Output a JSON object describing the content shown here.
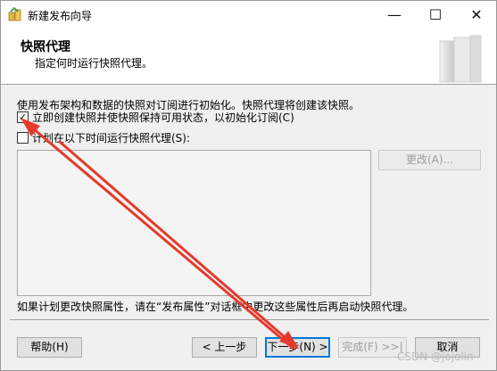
{
  "window": {
    "title": "新建发布向导",
    "minimize_label": "—",
    "maximize_label": "☐",
    "close_label": "✕"
  },
  "header": {
    "title": "快照代理",
    "subtitle": "指定何时运行快照代理。"
  },
  "body": {
    "intro": "使用发布架构和数据的快照对订阅进行初始化。快照代理将创建该快照。",
    "option_immediate": {
      "label": "立即创建快照并使快照保持可用状态，以初始化订阅(C)",
      "checked": true,
      "check_glyph": "✓"
    },
    "option_schedule": {
      "label": "计划在以下时间运行快照代理(S):",
      "checked": false
    },
    "change_button": "更改(A)...",
    "note": "如果计划更改快照属性，请在“发布属性”对话框中更改这些属性后再启动快照代理。"
  },
  "footer": {
    "help": "帮助(H)",
    "back": "< 上一步",
    "next": "下一步(N) >",
    "finish": "完成(F) >>|",
    "cancel": "取消"
  },
  "watermark": "CSDN @jojolin",
  "colors": {
    "annotation_arrow": "#e53a2b",
    "default_button_border": "#0078d7"
  }
}
